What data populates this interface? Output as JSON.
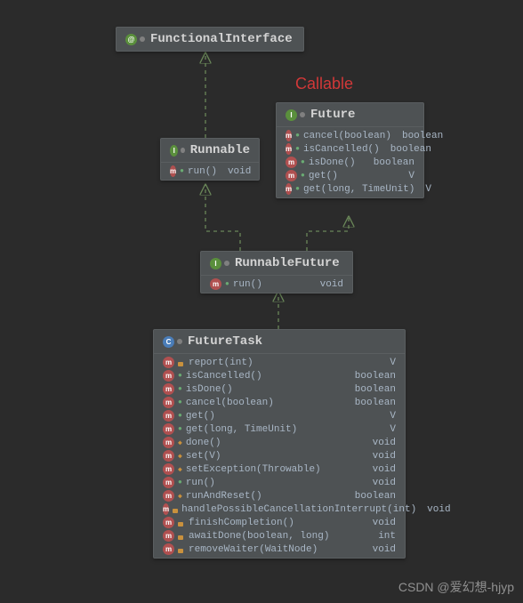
{
  "annotation": "Callable",
  "watermark": "CSDN @爱幻想-hjyp",
  "nodes": {
    "functionalInterface": {
      "name": "FunctionalInterface"
    },
    "runnable": {
      "name": "Runnable",
      "members": [
        {
          "vis": "pub",
          "name": "run()",
          "ret": "void"
        }
      ]
    },
    "future": {
      "name": "Future",
      "members": [
        {
          "vis": "pub",
          "name": "cancel(boolean)",
          "ret": "boolean"
        },
        {
          "vis": "pub",
          "name": "isCancelled()",
          "ret": "boolean"
        },
        {
          "vis": "pub",
          "name": "isDone()",
          "ret": "boolean"
        },
        {
          "vis": "pub",
          "name": "get()",
          "ret": "V"
        },
        {
          "vis": "pub",
          "name": "get(long, TimeUnit)",
          "ret": "V"
        }
      ]
    },
    "runnableFuture": {
      "name": "RunnableFuture",
      "members": [
        {
          "vis": "pub",
          "name": "run()",
          "ret": "void"
        }
      ]
    },
    "futureTask": {
      "name": "FutureTask",
      "members": [
        {
          "vis": "priv",
          "name": "report(int)",
          "ret": "V"
        },
        {
          "vis": "pub",
          "name": "isCancelled()",
          "ret": "boolean"
        },
        {
          "vis": "pub",
          "name": "isDone()",
          "ret": "boolean"
        },
        {
          "vis": "pub",
          "name": "cancel(boolean)",
          "ret": "boolean"
        },
        {
          "vis": "pub",
          "name": "get()",
          "ret": "V"
        },
        {
          "vis": "pub",
          "name": "get(long, TimeUnit)",
          "ret": "V"
        },
        {
          "vis": "prot",
          "name": "done()",
          "ret": "void"
        },
        {
          "vis": "prot",
          "name": "set(V)",
          "ret": "void"
        },
        {
          "vis": "prot",
          "name": "setException(Throwable)",
          "ret": "void"
        },
        {
          "vis": "pub",
          "name": "run()",
          "ret": "void"
        },
        {
          "vis": "prot",
          "name": "runAndReset()",
          "ret": "boolean"
        },
        {
          "vis": "priv",
          "name": "handlePossibleCancellationInterrupt(int)",
          "ret": "void"
        },
        {
          "vis": "priv",
          "name": "finishCompletion()",
          "ret": "void"
        },
        {
          "vis": "priv",
          "name": "awaitDone(boolean, long)",
          "ret": "int"
        },
        {
          "vis": "priv",
          "name": "removeWaiter(WaitNode)",
          "ret": "void"
        }
      ]
    }
  }
}
